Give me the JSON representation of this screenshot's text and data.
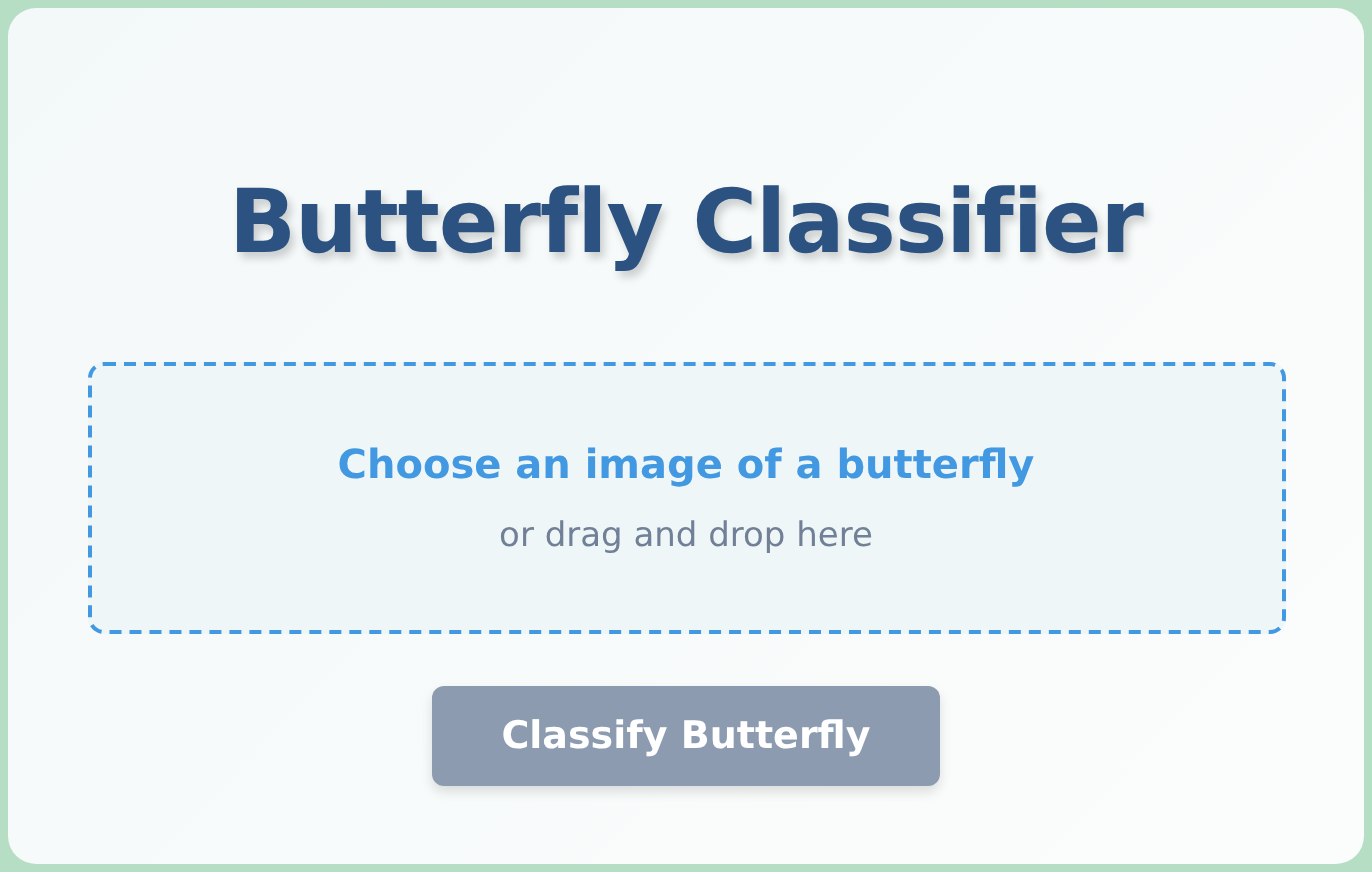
{
  "title": "Butterfly Classifier",
  "upload": {
    "prompt": "Choose an image of a butterfly",
    "hint": "or drag and drop here"
  },
  "button": {
    "label": "Classify Butterfly",
    "disabled": true
  }
}
